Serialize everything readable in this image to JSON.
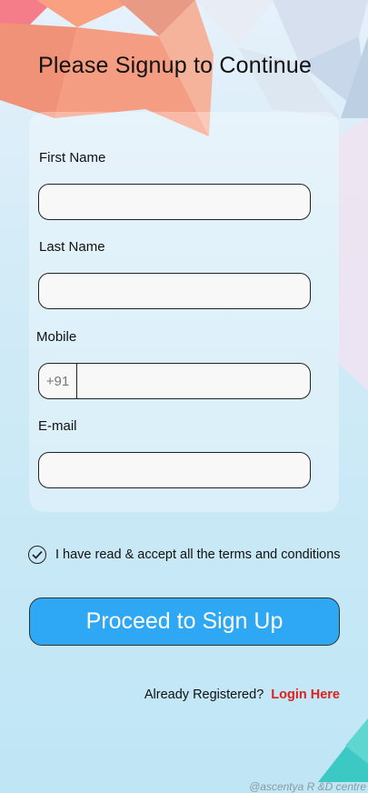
{
  "header": {
    "title": "Please Signup to Continue"
  },
  "form": {
    "first_name_label": "First Name",
    "first_name_value": "",
    "last_name_label": "Last Name",
    "last_name_value": "",
    "mobile_label": "Mobile",
    "mobile_prefix": "+91",
    "mobile_value": "",
    "email_label": "E-mail",
    "email_value": ""
  },
  "terms": {
    "text": "I have read & accept all the terms and conditions",
    "checked": true,
    "icon": "check-circle-icon"
  },
  "actions": {
    "proceed_label": "Proceed to Sign Up"
  },
  "footer": {
    "already_text": "Already Registered?",
    "login_label": "Login Here",
    "watermark": "@ascentya R &D centre"
  },
  "colors": {
    "primary_button": "#2ea8f4",
    "login_link": "#e0201a",
    "text": "#111111"
  }
}
